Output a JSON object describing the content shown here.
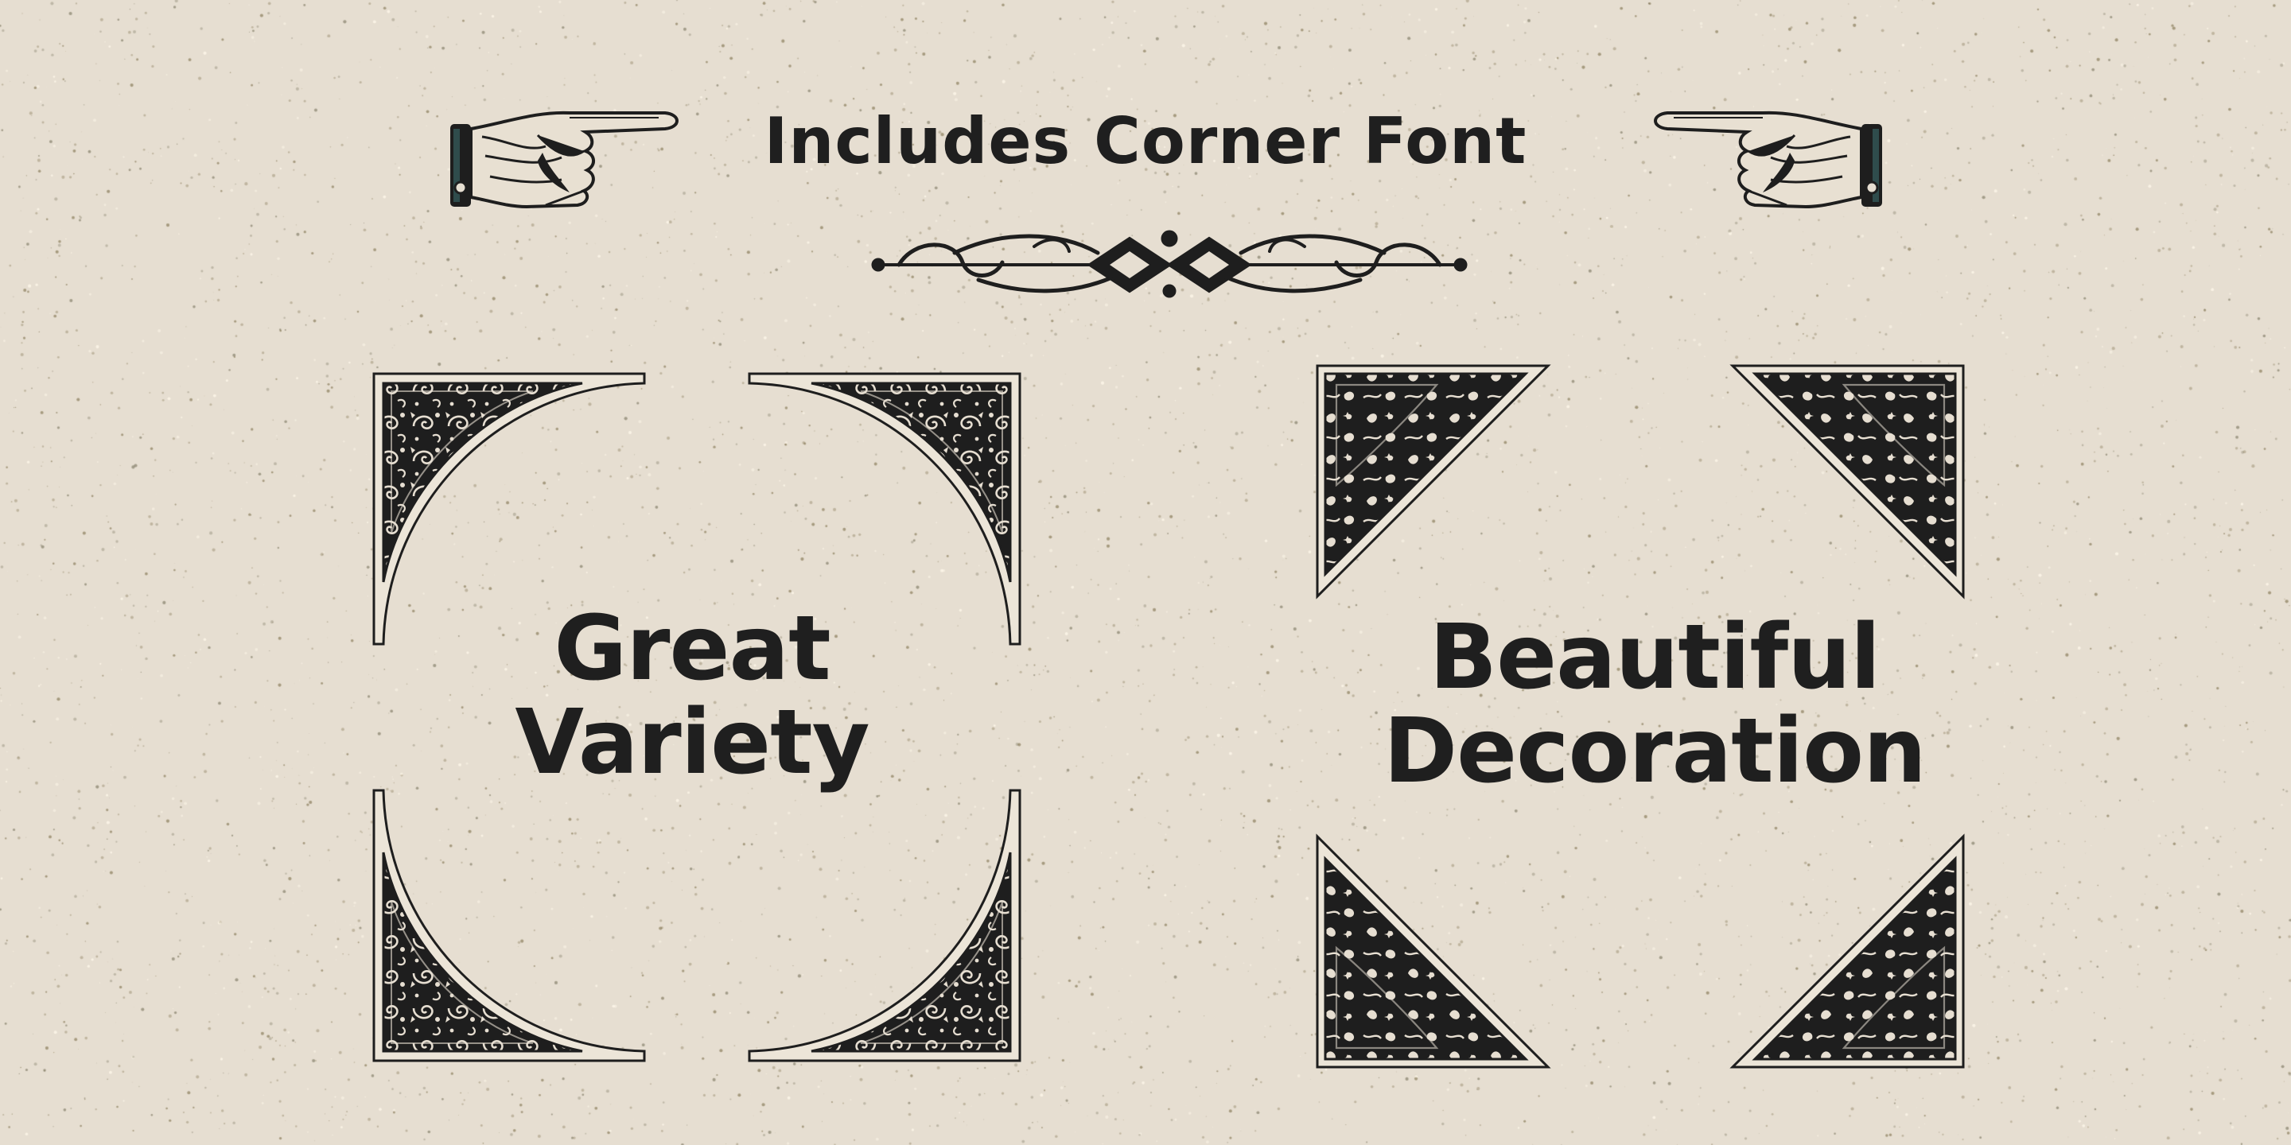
{
  "heading": "Includes Corner Font",
  "features": [
    {
      "line1": "Great",
      "line2": "Variety"
    },
    {
      "line1": "Beautiful",
      "line2": "Decoration"
    }
  ],
  "colors": {
    "background": "#e6ded1",
    "ink": "#1f1f1f",
    "speckle": "#8a7a55"
  },
  "icons": [
    "pointing-hand-right-icon",
    "pointing-hand-left-icon",
    "flourish-divider-icon",
    "corner-ornament-icon"
  ]
}
